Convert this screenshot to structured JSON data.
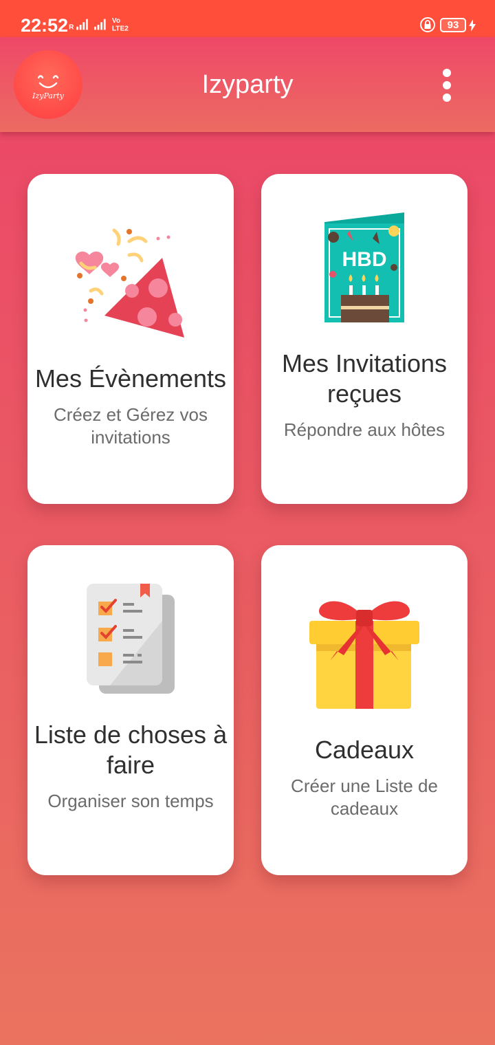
{
  "status_bar": {
    "time": "22:52",
    "battery": "93",
    "network_label": "Vo LTE2"
  },
  "app_bar": {
    "title": "Izyparty",
    "logo_text": "IzyParty",
    "menu_icon": "more-vert-icon"
  },
  "colors": {
    "status_bar": "#ff4f3b",
    "app_bar": "#ec4469",
    "background_top": "#ec4469",
    "background_bottom": "#ea735f",
    "card": "#ffffff"
  },
  "cards": [
    {
      "title": "Mes Évènements",
      "subtitle": "Créez et Gérez vos invitations",
      "icon": "party-popper-icon"
    },
    {
      "title": "Mes Invitations reçues",
      "subtitle": "Répondre aux hôtes",
      "icon": "birthday-card-icon",
      "icon_text": "HBD"
    },
    {
      "title": "Liste de choses à faire",
      "subtitle": "Organiser son temps",
      "icon": "checklist-icon"
    },
    {
      "title": "Cadeaux",
      "subtitle": "Créer une Liste de cadeaux",
      "icon": "gift-icon"
    }
  ]
}
